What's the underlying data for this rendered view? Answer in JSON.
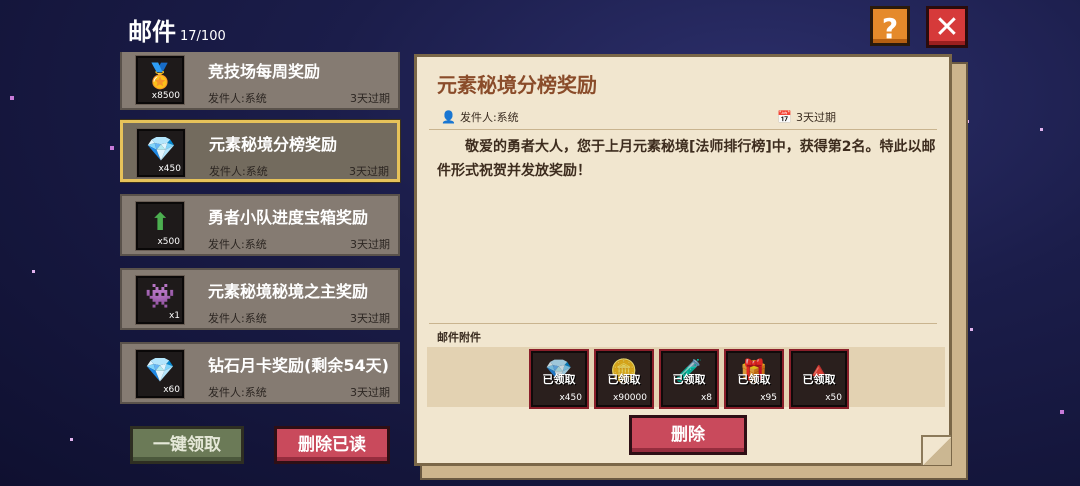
{
  "header": {
    "title": "邮件",
    "count": "17/100",
    "help_label": "?",
    "close_label": "✕"
  },
  "mail_list": {
    "items": [
      {
        "title": "竞技场每周奖励",
        "sender": "发件人:系统",
        "expiry": "3天过期",
        "qty": "x8500",
        "icon": "medal-icon",
        "selected": false
      },
      {
        "title": "元素秘境分榜奖励",
        "sender": "发件人:系统",
        "expiry": "3天过期",
        "qty": "x450",
        "icon": "diamond-icon",
        "selected": true
      },
      {
        "title": "勇者小队进度宝箱奖励",
        "sender": "发件人:系统",
        "expiry": "3天过期",
        "qty": "x500",
        "icon": "upgrade-arrow-icon",
        "selected": false
      },
      {
        "title": "元素秘境秘境之主奖励",
        "sender": "发件人:系统",
        "expiry": "3天过期",
        "qty": "x1",
        "icon": "avatar-frame-icon",
        "selected": false
      },
      {
        "title": "钻石月卡奖励(剩余54天)",
        "sender": "发件人:系统",
        "expiry": "3天过期",
        "qty": "x60",
        "icon": "diamond-icon",
        "selected": false
      }
    ]
  },
  "buttons": {
    "claim_all": "一键领取",
    "delete_read": "删除已读",
    "delete": "删除"
  },
  "detail": {
    "title": "元素秘境分榜奖励",
    "sender": "发件人:系统",
    "expiry": "3天过期",
    "body": "敬爱的勇者大人，您于上月元素秘境[法师排行榜]中，获得第2名。特此以邮件形式祝贺并发放奖励！",
    "attachments_label": "邮件附件",
    "attachments": [
      {
        "status": "已领取",
        "qty": "x450",
        "icon": "diamond-icon"
      },
      {
        "status": "已领取",
        "qty": "x90000",
        "icon": "gold-coin-icon"
      },
      {
        "status": "已领取",
        "qty": "x8",
        "icon": "potion-icon"
      },
      {
        "status": "已领取",
        "qty": "x95",
        "icon": "gem-chest-icon"
      },
      {
        "status": "已领取",
        "qty": "x50",
        "icon": "upgrade-stone-icon"
      }
    ]
  },
  "colors": {
    "accent_gold": "#e6c25a",
    "title_brown": "#8a4c2a",
    "delete_red": "#c94a5c",
    "claim_green": "#6b7a57"
  }
}
